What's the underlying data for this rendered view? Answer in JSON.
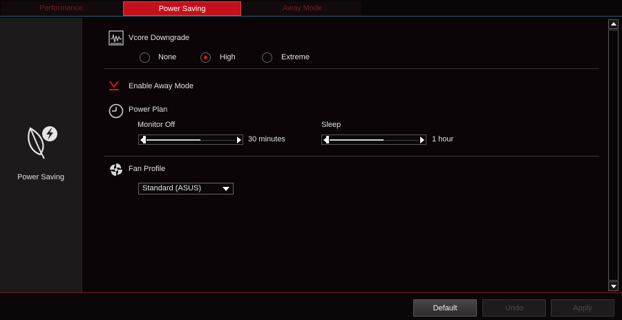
{
  "tabs": [
    {
      "label": "Performance",
      "active": false
    },
    {
      "label": "Power Saving",
      "active": true
    },
    {
      "label": "Away Mode",
      "active": false
    }
  ],
  "sidebar": {
    "icon": "leaf-bolt-icon",
    "label": "Power Saving"
  },
  "vcore": {
    "title": "Vcore Downgrade",
    "options": [
      "None",
      "High",
      "Extreme"
    ],
    "selected": "High"
  },
  "away_mode": {
    "label": "Enable Away Mode",
    "checked": true
  },
  "power_plan": {
    "title": "Power Plan",
    "monitor_off": {
      "label": "Monitor Off",
      "value": "30 minutes"
    },
    "sleep": {
      "label": "Sleep",
      "value": "1 hour"
    }
  },
  "fan_profile": {
    "title": "Fan Profile",
    "selected": "Standard (ASUS)"
  },
  "footer": {
    "default_label": "Default",
    "undo_label": "Undo",
    "apply_label": "Apply"
  },
  "colors": {
    "accent": "#c4101c",
    "background": "#0b0507",
    "sidebar": "#1c1a1b",
    "border_teal": "#1f5f72"
  }
}
